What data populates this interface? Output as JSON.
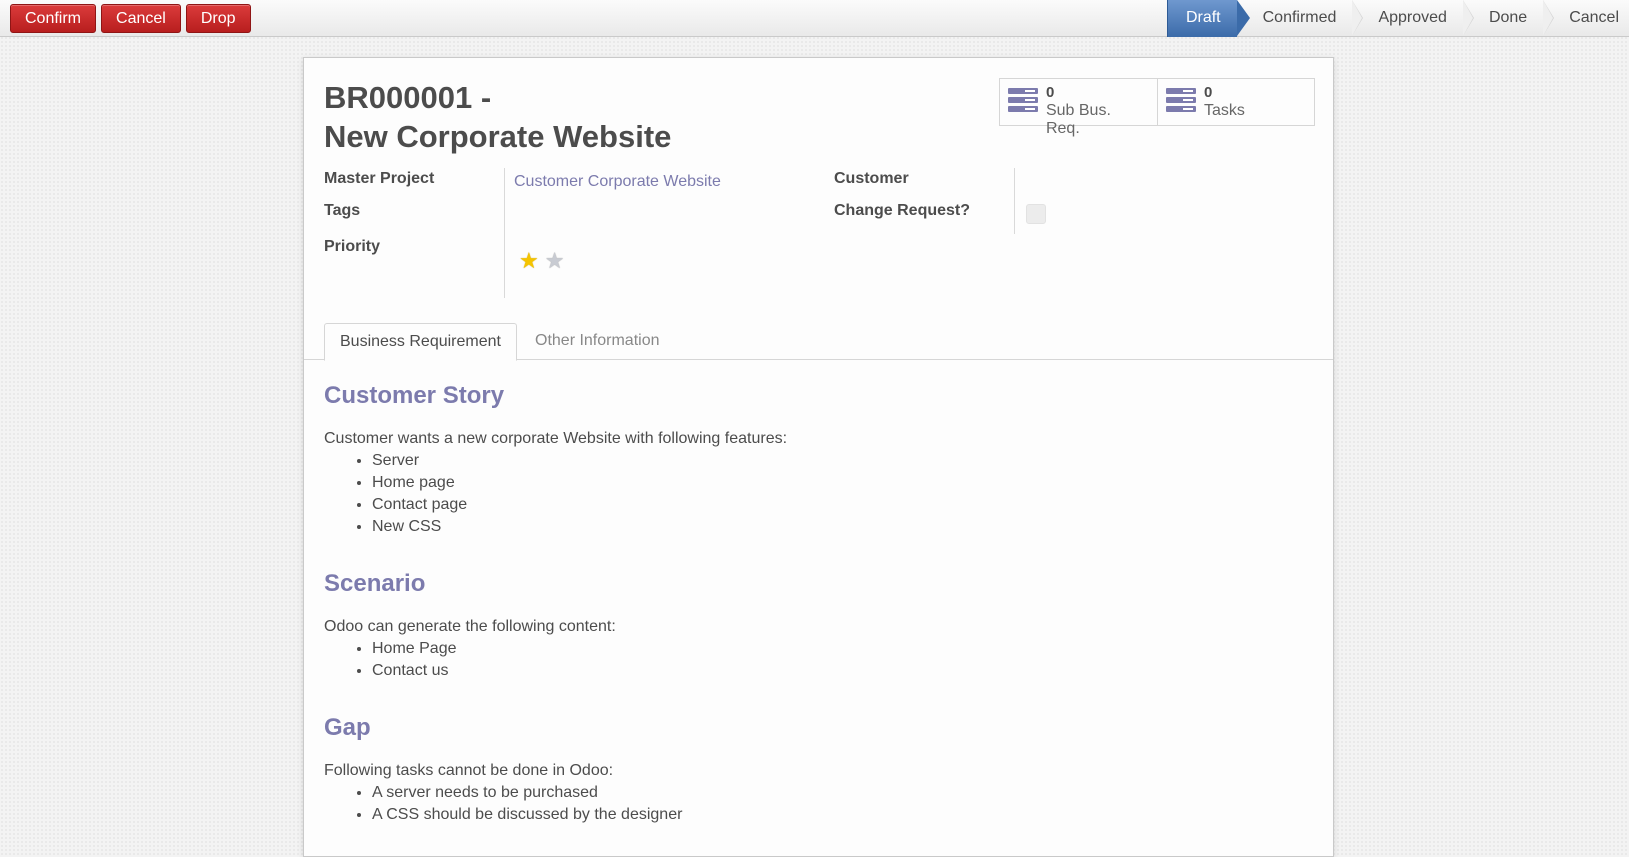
{
  "statusbar": {
    "buttons": [
      "Confirm",
      "Cancel",
      "Drop"
    ],
    "stages": [
      {
        "label": "Draft",
        "active": true
      },
      {
        "label": "Confirmed",
        "active": false
      },
      {
        "label": "Approved",
        "active": false
      },
      {
        "label": "Done",
        "active": false
      },
      {
        "label": "Cancel",
        "active": false
      }
    ]
  },
  "smart_buttons": [
    {
      "icon": "list-icon",
      "count": "0",
      "label": "Sub Bus. Req."
    },
    {
      "icon": "list-icon",
      "count": "0",
      "label": "Tasks"
    }
  ],
  "record": {
    "reference": "BR000001 -",
    "name": "New Corporate Website"
  },
  "fields": {
    "master_project": {
      "label": "Master Project",
      "value": "Customer Corporate Website"
    },
    "tags": {
      "label": "Tags",
      "value": ""
    },
    "priority": {
      "label": "Priority",
      "value": 1,
      "max": 2
    },
    "customer": {
      "label": "Customer",
      "value": ""
    },
    "change_request": {
      "label": "Change Request?",
      "checked": false
    }
  },
  "tabs": [
    {
      "label": "Business Requirement",
      "active": true
    },
    {
      "label": "Other Information",
      "active": false
    }
  ],
  "colors": {
    "accent": "#7c7bad",
    "danger": "#c12727",
    "stage_active": "#4a7ab8"
  },
  "content": {
    "sections": [
      {
        "heading": "Customer Story",
        "intro": "Customer wants a new corporate Website with following features:",
        "items": [
          "Server",
          "Home page",
          "Contact page",
          "New CSS"
        ]
      },
      {
        "heading": "Scenario",
        "intro": "Odoo can generate the following content:",
        "items": [
          "Home Page",
          "Contact us"
        ]
      },
      {
        "heading": "Gap",
        "intro": "Following tasks cannot be done in Odoo:",
        "items": [
          "A server needs to be purchased",
          "A CSS should be discussed by the designer"
        ]
      }
    ]
  }
}
